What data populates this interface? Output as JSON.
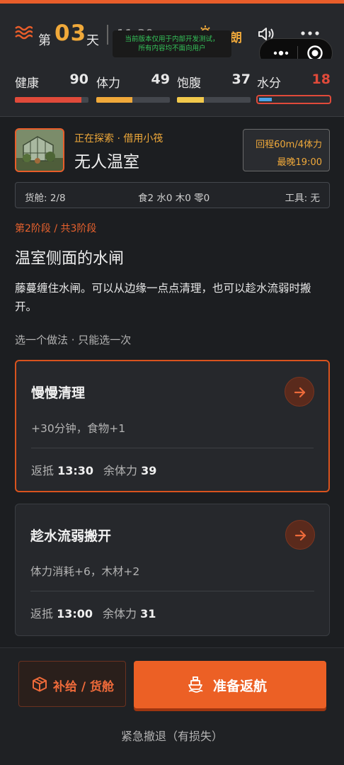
{
  "header": {
    "day_prefix": "第",
    "day_number": "03",
    "day_suffix": "天",
    "time": "11:30",
    "weather": "晴朗",
    "weather_icon": "sun-cloud-icon",
    "menu_icon": "waves-icon",
    "sound_icon": "speaker-icon",
    "more_icon": "more-dots-icon"
  },
  "dev_notice": {
    "line1": "当前版本仅用于内部开发测试，",
    "line2": "所有内容均不面向用户"
  },
  "stats": [
    {
      "label": "健康",
      "value": "90",
      "max": 100,
      "color": "#e04a3a"
    },
    {
      "label": "体力",
      "value": "49",
      "max": 100,
      "color": "#f0a93a"
    },
    {
      "label": "饱腹",
      "value": "37",
      "max": 100,
      "color": "#f2c94c"
    },
    {
      "label": "水分",
      "value": "18",
      "max": 100,
      "color": "#4aa3e8",
      "warning_color": "#e04a3a"
    }
  ],
  "location": {
    "status": "正在探索 · 借用小筏",
    "name": "无人温室",
    "return_cost": "回程60m/4体力",
    "latest_time": "最晚19:00"
  },
  "cargo": {
    "slots": "货舱: 2/8",
    "resources": "食2 水0 木0 零0",
    "tools": "工具: 无"
  },
  "event": {
    "stage": "第2阶段 / 共3阶段",
    "title": "温室侧面的水闸",
    "description": "藤蔓缠住水闸。可以从边缘一点点清理，也可以趁水流弱时搬开。",
    "hint": "选一个做法 · 只能选一次"
  },
  "options": [
    {
      "title": "慢慢清理",
      "effect": "+30分钟，食物+1",
      "arrive_label": "返抵",
      "arrive_time": "13:30",
      "stamina_label": "余体力",
      "stamina_value": "39",
      "selected": true
    },
    {
      "title": "趁水流弱搬开",
      "effect": "体力消耗+6，木材+2",
      "arrive_label": "返抵",
      "arrive_time": "13:00",
      "stamina_label": "余体力",
      "stamina_value": "31",
      "selected": false
    }
  ],
  "actions": {
    "supply_label": "补给 / 货舱",
    "return_label": "准备返航",
    "retreat_label": "紧急撤退（有损失）"
  },
  "capsule": {
    "more_icon": "capsule-more-icon",
    "close_icon": "capsule-close-icon"
  },
  "colors": {
    "accent": "#ec6025",
    "gold": "#f0a93a",
    "background": "#1c1e21"
  }
}
